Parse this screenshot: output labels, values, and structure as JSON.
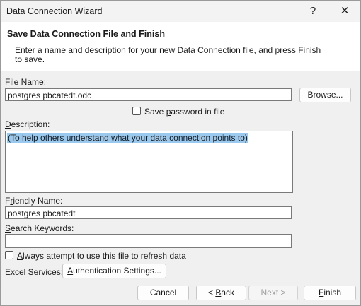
{
  "window": {
    "title": "Data Connection Wizard",
    "help_label": "?",
    "close_label": "✕"
  },
  "header": {
    "title": "Save Data Connection File and Finish",
    "description": "Enter a name and description for your new Data Connection file, and press Finish to save."
  },
  "file_name": {
    "label_pre": "File ",
    "label_u": "N",
    "label_post": "ame:",
    "value": "postgres pbcatedt.odc",
    "browse_label": "Browse..."
  },
  "save_password": {
    "label_pre": "Save ",
    "label_u": "p",
    "label_post": "assword in file",
    "checked": false
  },
  "description": {
    "label_u": "D",
    "label_post": "escription:",
    "value": "(To help others understand what your data connection points to)"
  },
  "friendly_name": {
    "label_pre": "F",
    "label_u": "r",
    "label_post": "iendly Name:",
    "value": "postgres pbcatedt"
  },
  "search_keywords": {
    "label_u": "S",
    "label_post": "earch Keywords:",
    "value": ""
  },
  "always_refresh": {
    "label_u": "A",
    "label_post": "lways attempt to use this file to refresh data",
    "checked": false
  },
  "excel_services": {
    "label": "Excel Services:",
    "auth_u": "A",
    "auth_post": "uthentication Settings..."
  },
  "buttons": {
    "cancel": "Cancel",
    "back_pre": "< ",
    "back_u": "B",
    "back_post": "ack",
    "next": "Next >",
    "finish_u": "F",
    "finish_post": "inish"
  }
}
